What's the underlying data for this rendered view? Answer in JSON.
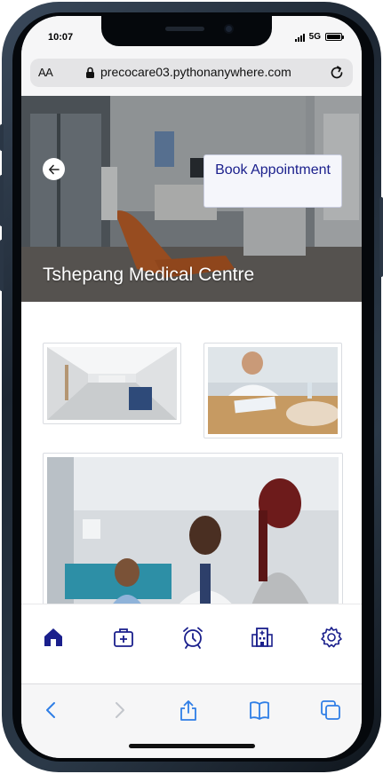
{
  "status_bar": {
    "time": "10:07",
    "network": "5G"
  },
  "browser": {
    "text_size_label": "AA",
    "url": "precocare03.pythonanywhere.com"
  },
  "hero": {
    "book_label": "Book Appointment",
    "title": "Tshepang Medical Centre"
  },
  "gallery": {
    "photos": [
      "hospital corridor",
      "doctor consultation",
      "doctor with patient"
    ]
  },
  "tab_bar": {
    "items": [
      "home-icon",
      "medical-kit-icon",
      "alarm-clock-icon",
      "hospital-icon",
      "settings-icon"
    ],
    "active": "home-icon",
    "color": "#1a1f8c"
  },
  "safari_toolbar": {
    "items": [
      "back-icon",
      "forward-icon",
      "share-icon",
      "bookmarks-icon",
      "tabs-icon"
    ],
    "color": "#2f7ee6"
  }
}
